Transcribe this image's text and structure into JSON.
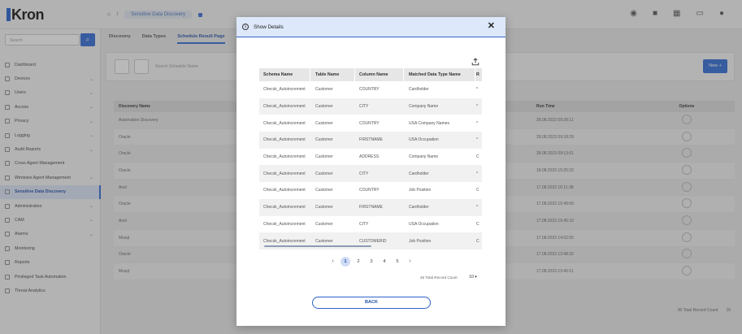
{
  "app": {
    "logo": "Kron",
    "breadcrumb": [
      "Sensitive Data Discovery"
    ],
    "top_icons": [
      "eye-icon",
      "lock-icon",
      "grid-icon",
      "monitor-icon",
      "user-icon"
    ]
  },
  "sidebar": {
    "search_placeholder": "Search",
    "items": [
      {
        "label": "Dashboard",
        "chevron": false,
        "active": false
      },
      {
        "label": "Devices",
        "chevron": true,
        "active": false
      },
      {
        "label": "Users",
        "chevron": true,
        "active": false
      },
      {
        "label": "Access",
        "chevron": true,
        "active": false
      },
      {
        "label": "Privacy",
        "chevron": true,
        "active": false
      },
      {
        "label": "Logging",
        "chevron": true,
        "active": false
      },
      {
        "label": "Audit Reports",
        "chevron": true,
        "active": false
      },
      {
        "label": "Cross Agent Management",
        "chevron": false,
        "active": false
      },
      {
        "label": "Windows Agent Management",
        "chevron": true,
        "active": false
      },
      {
        "label": "Sensitive Data Discovery",
        "chevron": false,
        "active": true
      },
      {
        "label": "Administration",
        "chevron": true,
        "active": false
      },
      {
        "label": "CAM",
        "chevron": true,
        "active": false
      },
      {
        "label": "Alarms",
        "chevron": true,
        "active": false
      },
      {
        "label": "Monitoring",
        "chevron": false,
        "active": false
      },
      {
        "label": "Reports",
        "chevron": false,
        "active": false
      },
      {
        "label": "Privileged Task Automation",
        "chevron": false,
        "active": false
      },
      {
        "label": "Threat Analytics",
        "chevron": false,
        "active": false
      }
    ]
  },
  "background": {
    "tabs": [
      "Discovery",
      "Data Types",
      "Schedule Result Page"
    ],
    "active_tab": 2,
    "filter_placeholder": "Search Schedule Name",
    "new_button": "New +",
    "columns": [
      "Discovery Name",
      "Run Time",
      "Options"
    ],
    "rows": [
      {
        "name": "Automation Discovery",
        "time": "28.08.2023 09:28:11"
      },
      {
        "name": "Oracle",
        "time": "28.08.2023 09:18:29"
      },
      {
        "name": "Oracle",
        "time": "28.08.2023 09:13:01"
      },
      {
        "name": "Oracle",
        "time": "18.08.2023 15:25:22"
      },
      {
        "name": "Aixd",
        "time": "17.08.2023 16:11:38"
      },
      {
        "name": "Oracle",
        "time": "17.08.2023 15:49:09"
      },
      {
        "name": "Aixd",
        "time": "17.08.2023 15:45:10"
      },
      {
        "name": "Mssql",
        "time": "17.08.2023 14:02:55"
      },
      {
        "name": "Oracle",
        "time": "17.08.2023 13:48:32"
      },
      {
        "name": "Mssql",
        "time": "17.08.2023 13:40:11"
      }
    ],
    "footer_count": "30 Total Record Count",
    "footer_page_size": "10"
  },
  "modal": {
    "title": "Show Details",
    "columns": [
      "Schema Name",
      "Table Name",
      "Column Name",
      "Matched Data Type Name",
      "R"
    ],
    "rows": [
      {
        "schema": "Checsk_Autoincrement",
        "table": "Customer",
        "column": "COUNTRY",
        "type": "Cardholder",
        "r": "^"
      },
      {
        "schema": "Checsk_Autoincrement",
        "table": "Customer",
        "column": "CITY",
        "type": "Company Name",
        "r": "^"
      },
      {
        "schema": "Checsk_Autoincrement",
        "table": "Customer",
        "column": "COUNTRY",
        "type": "USA Company Names",
        "r": "^"
      },
      {
        "schema": "Checsk_Autoincrement",
        "table": "Customer",
        "column": "FIRSTNAME",
        "type": "USA Occupation",
        "r": "^"
      },
      {
        "schema": "Checsk_Autoincrement",
        "table": "Customer",
        "column": "ADDRESS",
        "type": "Company Name",
        "r": "C"
      },
      {
        "schema": "Checsk_Autoincrement",
        "table": "Customer",
        "column": "CITY",
        "type": "Cardholder",
        "r": "^"
      },
      {
        "schema": "Checsk_Autoincrement",
        "table": "Customer",
        "column": "COUNTRY",
        "type": "Job Position",
        "r": "C"
      },
      {
        "schema": "Checsk_Autoincrement",
        "table": "Customer",
        "column": "FIRSTNAME",
        "type": "Cardholder",
        "r": "^"
      },
      {
        "schema": "Checsk_Autoincrement",
        "table": "Customer",
        "column": "CITY",
        "type": "USA Occupation",
        "r": "C"
      },
      {
        "schema": "Checsk_Autoincrement",
        "table": "Customer",
        "column": "CUSTOMERID",
        "type": "Job Position",
        "r": "C"
      }
    ],
    "pagination": {
      "pages": [
        "1",
        "2",
        "3",
        "4",
        "5"
      ],
      "current": "1",
      "prev": "‹",
      "next": "›"
    },
    "record_count_label": "46 Total Record Count",
    "page_size": "10 ▾",
    "back_button": "BACK"
  },
  "colors": {
    "accent": "#2e62c9",
    "header_bg": "#dde8fa"
  }
}
